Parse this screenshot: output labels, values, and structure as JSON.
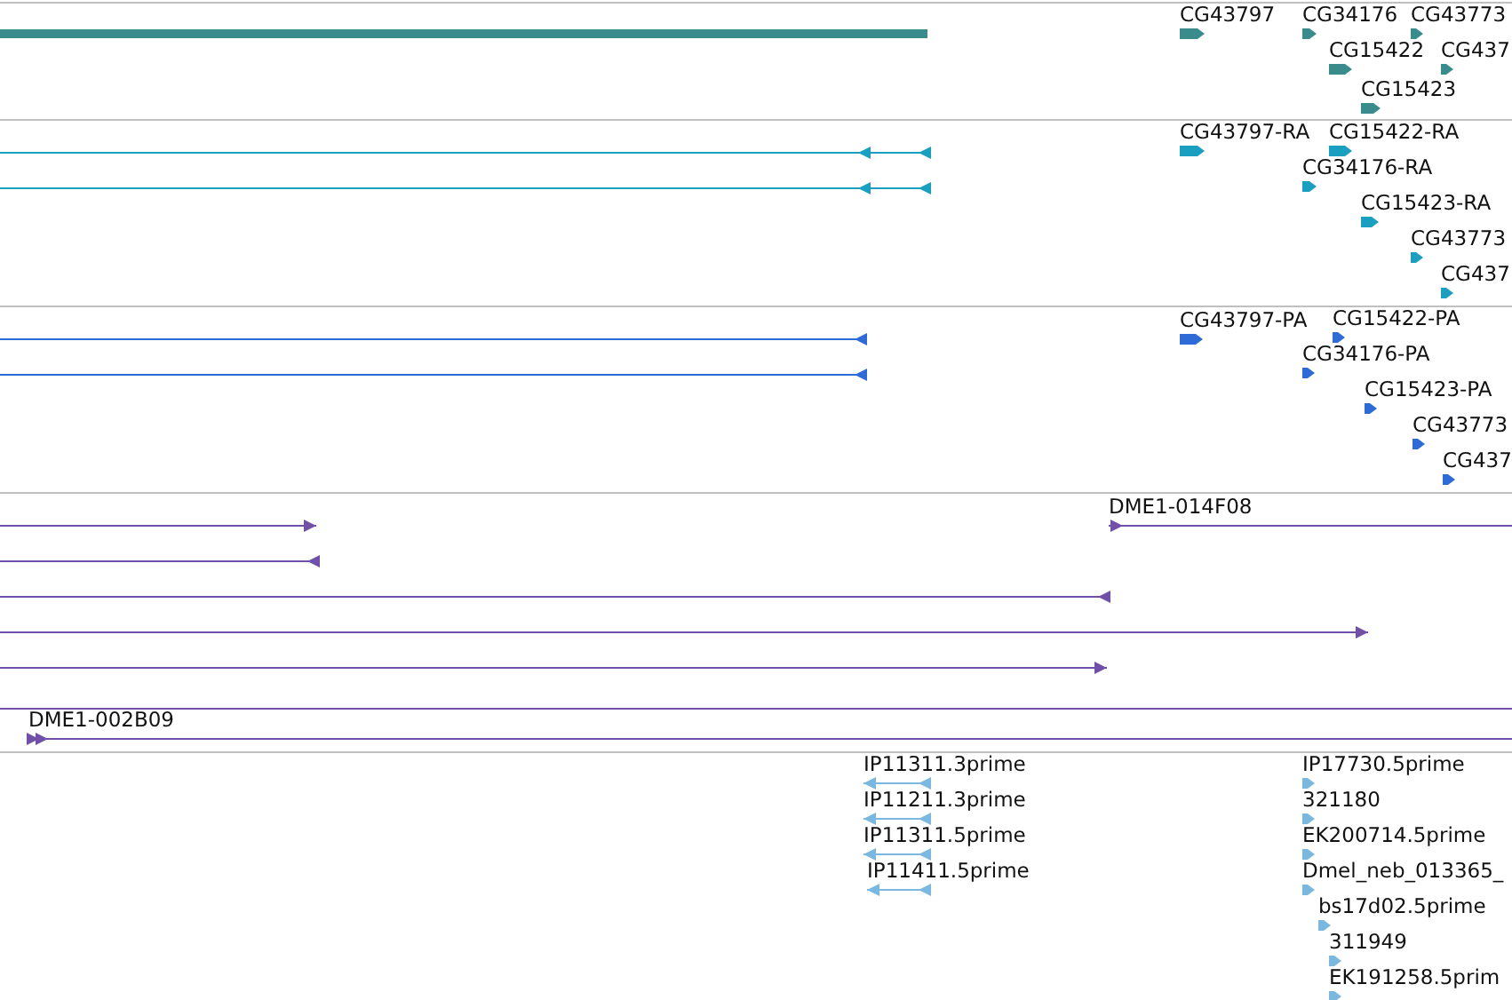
{
  "tracks": [
    {
      "color": "#3a8c8c",
      "features": [
        {
          "kind": "bar"
        },
        {
          "kind": "block",
          "label": "CG43797",
          "reverse": false
        },
        {
          "kind": "block",
          "label": "CG34176",
          "reverse": false
        },
        {
          "kind": "block",
          "label": "CG43773",
          "reverse": false
        },
        {
          "kind": "block",
          "label": "CG15422",
          "reverse": false
        },
        {
          "kind": "block",
          "label": "CG437",
          "reverse": false
        },
        {
          "kind": "block",
          "label": "CG15423",
          "reverse": false
        }
      ]
    },
    {
      "color": "#1a9fc0",
      "features": [
        {
          "kind": "span",
          "reverse": true
        },
        {
          "kind": "span",
          "reverse": true
        },
        {
          "kind": "block",
          "label": "CG43797-RA",
          "reverse": false
        },
        {
          "kind": "block",
          "label": "CG15422-RA",
          "reverse": false
        },
        {
          "kind": "block",
          "label": "CG34176-RA",
          "reverse": false
        },
        {
          "kind": "block",
          "label": "CG15423-RA",
          "reverse": false
        },
        {
          "kind": "block",
          "label": "CG43773",
          "reverse": false
        },
        {
          "kind": "block",
          "label": "CG437",
          "reverse": false
        }
      ]
    },
    {
      "color": "#2f6bd6",
      "features": [
        {
          "kind": "span",
          "reverse": true
        },
        {
          "kind": "span",
          "reverse": true
        },
        {
          "kind": "block",
          "label": "CG43797-PA",
          "reverse": false
        },
        {
          "kind": "block",
          "label": "CG15422-PA",
          "reverse": false
        },
        {
          "kind": "block",
          "label": "CG34176-PA",
          "reverse": false
        },
        {
          "kind": "block",
          "label": "CG15423-PA",
          "reverse": false
        },
        {
          "kind": "block",
          "label": "CG43773",
          "reverse": false
        },
        {
          "kind": "block",
          "label": "CG437",
          "reverse": false
        }
      ]
    },
    {
      "color": "#7050a8",
      "features": [
        {
          "kind": "span",
          "label": "DME1-014F08",
          "reverse": false
        },
        {
          "kind": "span",
          "reverse": false
        },
        {
          "kind": "span",
          "reverse": true
        },
        {
          "kind": "span",
          "reverse": true
        },
        {
          "kind": "span",
          "reverse": false
        },
        {
          "kind": "span",
          "reverse": false
        },
        {
          "kind": "bar"
        },
        {
          "kind": "span",
          "label": "DME1-002B09",
          "reverse": false
        }
      ]
    },
    {
      "color": "#7ab8e0",
      "features": [
        {
          "kind": "span",
          "label": "IP11311.3prime",
          "reverse": true
        },
        {
          "kind": "span",
          "label": "IP11211.3prime",
          "reverse": true
        },
        {
          "kind": "span",
          "label": "IP11311.5prime",
          "reverse": true
        },
        {
          "kind": "span",
          "label": "IP11411.5prime",
          "reverse": true
        },
        {
          "kind": "block",
          "label": "IP17730.5prime",
          "reverse": false
        },
        {
          "kind": "block",
          "label": "321180",
          "reverse": false
        },
        {
          "kind": "block",
          "label": "EK200714.5prime",
          "reverse": false
        },
        {
          "kind": "block",
          "label": "Dmel_neb_013365_",
          "reverse": false
        },
        {
          "kind": "block",
          "label": "bs17d02.5prime",
          "reverse": false
        },
        {
          "kind": "block",
          "label": "311949",
          "reverse": false
        },
        {
          "kind": "block",
          "label": "EK191258.5prim",
          "reverse": false
        }
      ]
    }
  ]
}
